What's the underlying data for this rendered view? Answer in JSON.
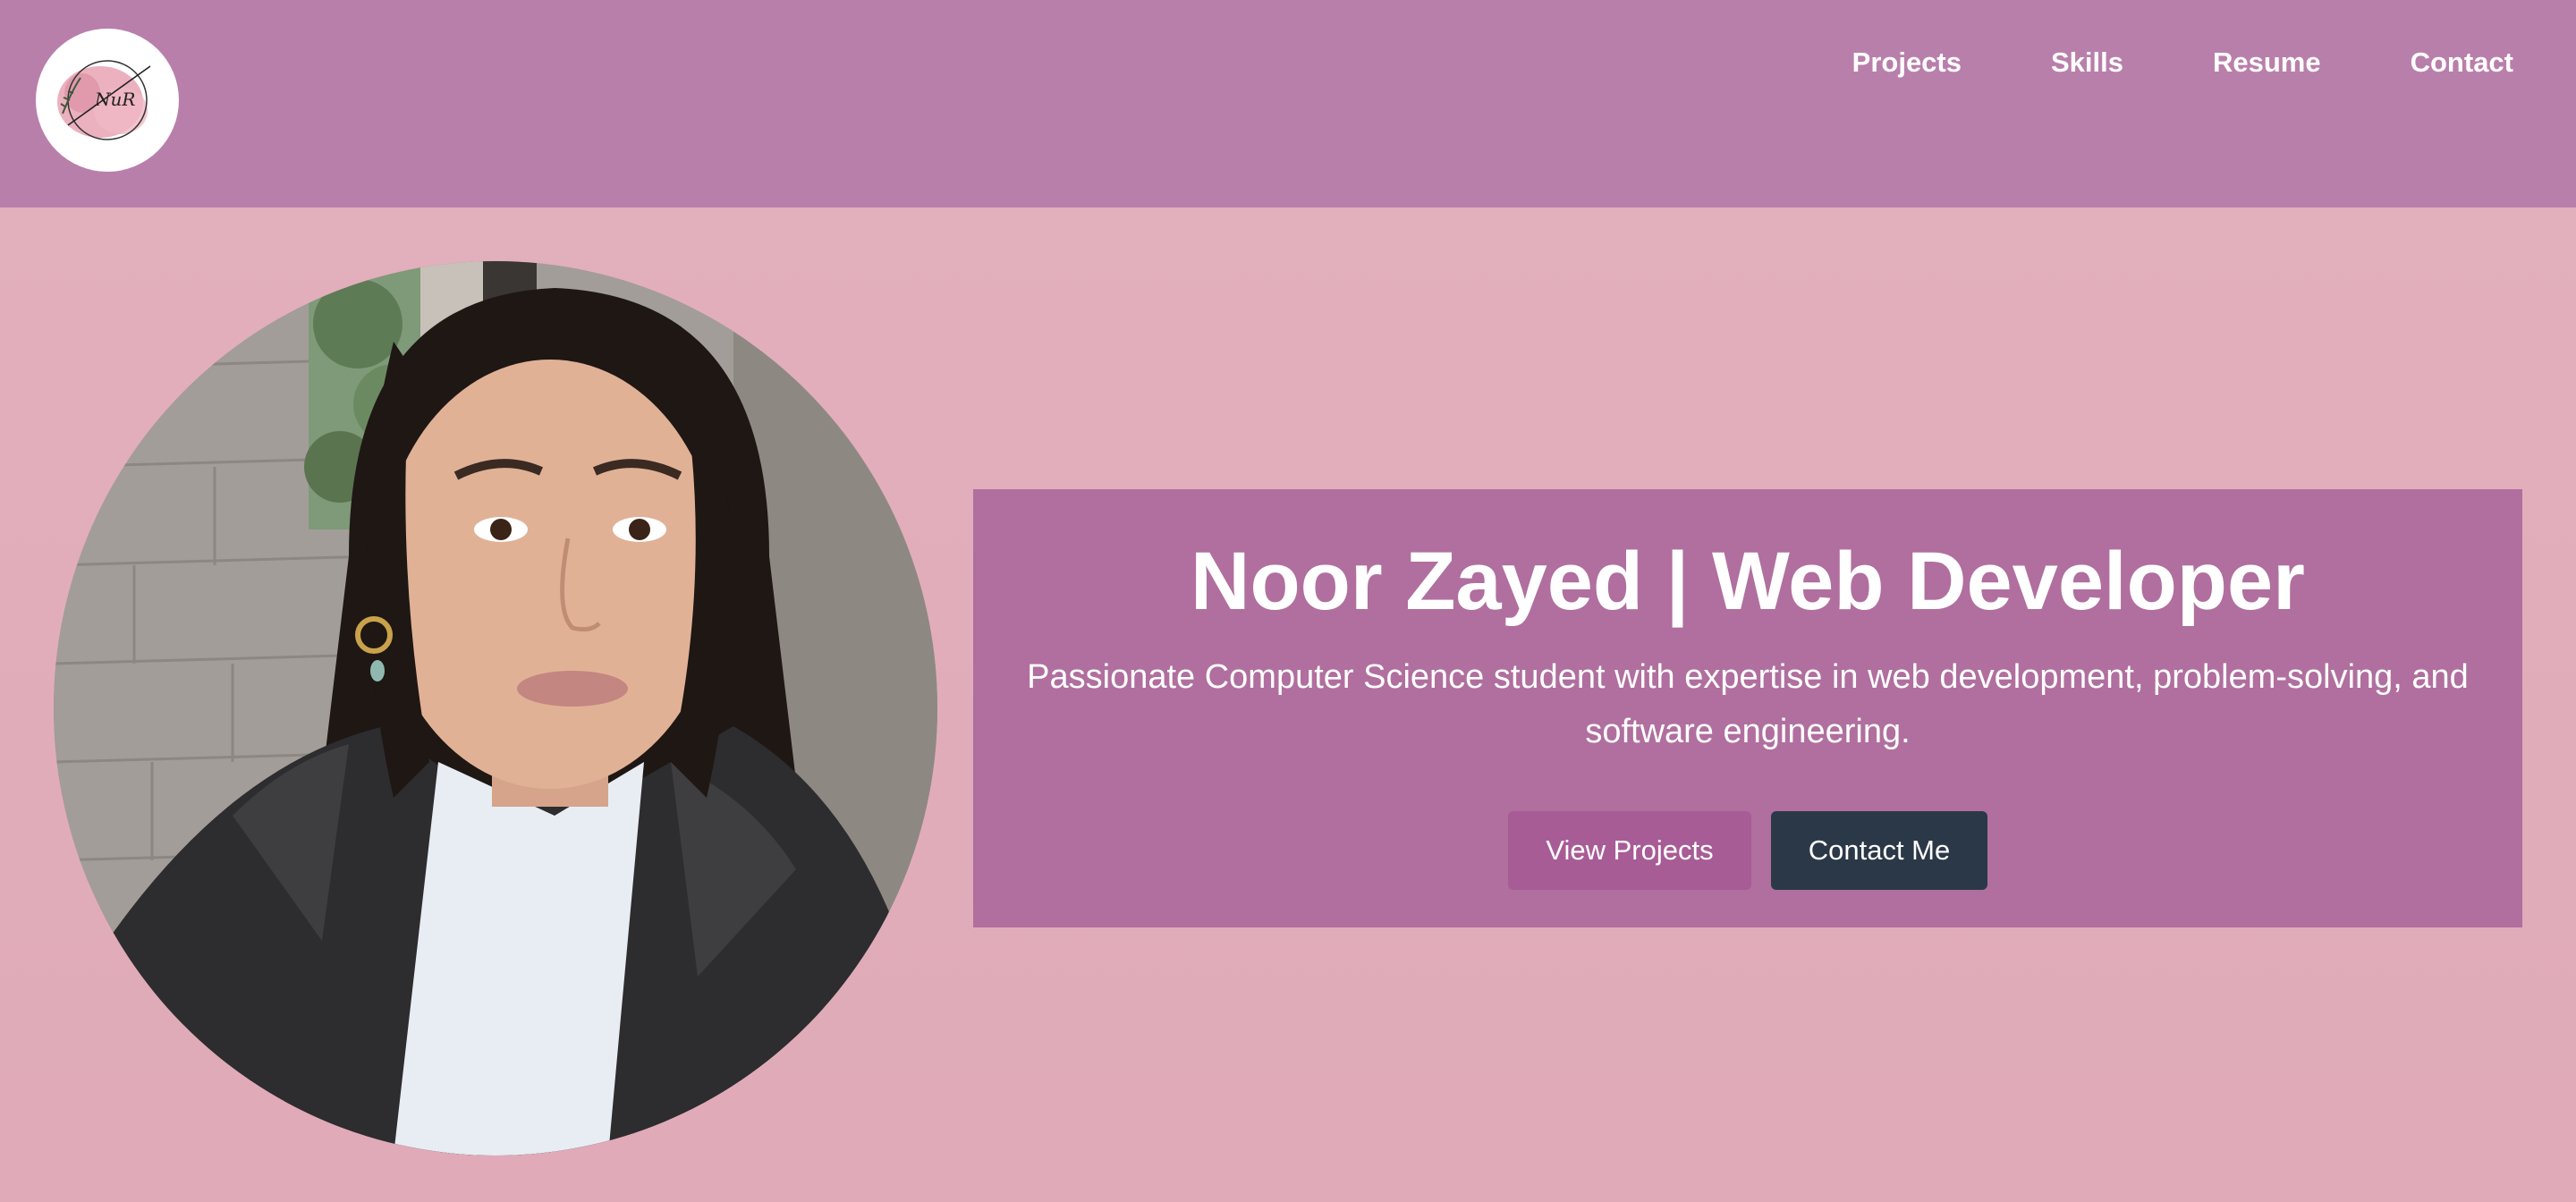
{
  "header": {
    "logo_text": "NuR",
    "nav": [
      {
        "label": "Projects"
      },
      {
        "label": "Skills"
      },
      {
        "label": "Resume"
      },
      {
        "label": "Contact"
      }
    ]
  },
  "hero": {
    "title": "Noor Zayed | Web Developer",
    "subtitle": "Passionate Computer Science student with expertise in web development, problem-solving, and software engineering.",
    "primary_button": "View Projects",
    "secondary_button": "Contact Me"
  },
  "colors": {
    "header_bg": "#b97fab",
    "page_bg": "#e3b0bd",
    "card_bg": "#b06f9e",
    "primary_button": "#a85c96",
    "secondary_button": "#2b3848"
  }
}
